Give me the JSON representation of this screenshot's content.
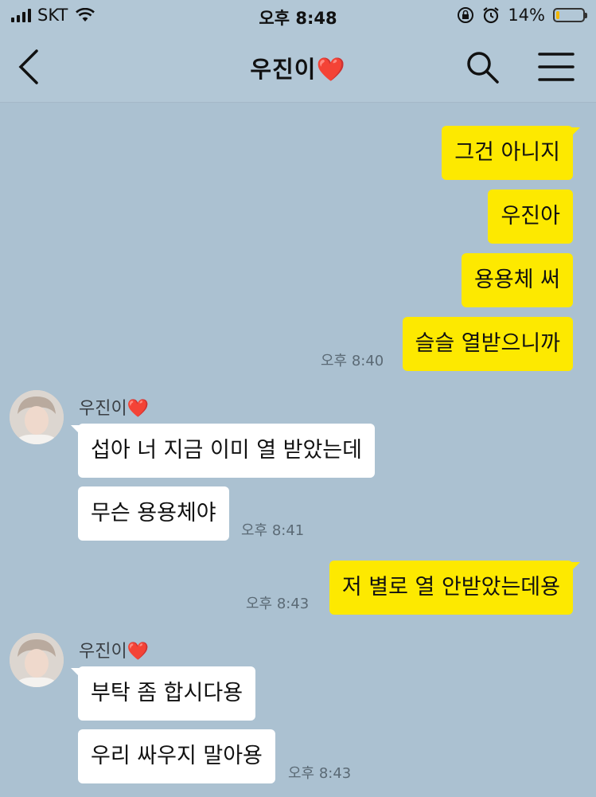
{
  "status_bar": {
    "carrier": "SKT",
    "time": "오후 8:48",
    "battery": "14%",
    "battery_level": 0.14
  },
  "header": {
    "title": "우진이",
    "title_emoji": "❤️"
  },
  "messages": [
    {
      "from": "me",
      "text": "그건 아니지"
    },
    {
      "from": "me",
      "text": "우진아"
    },
    {
      "from": "me",
      "text": "용용체 써"
    },
    {
      "from": "me",
      "text": "슬슬 열받으니까",
      "time": "오후 8:40"
    },
    {
      "from": "other",
      "sender": "우진이",
      "sender_emoji": "❤️",
      "text": "섭아 너 지금 이미 열 받았는데"
    },
    {
      "from": "other",
      "text": "무슨 용용체야",
      "time": "오후 8:41"
    },
    {
      "from": "me",
      "text": "저 별로 열 안받았는데용",
      "time": "오후 8:43"
    },
    {
      "from": "other",
      "sender": "우진이",
      "sender_emoji": "❤️",
      "text": "부탁 좀 합시다용"
    },
    {
      "from": "other",
      "text": "우리 싸우지 말아용",
      "time": "오후 8:43"
    }
  ],
  "colors": {
    "chat_background": "#abc1d1",
    "my_bubble": "#fde900",
    "their_bubble": "#ffffff"
  }
}
